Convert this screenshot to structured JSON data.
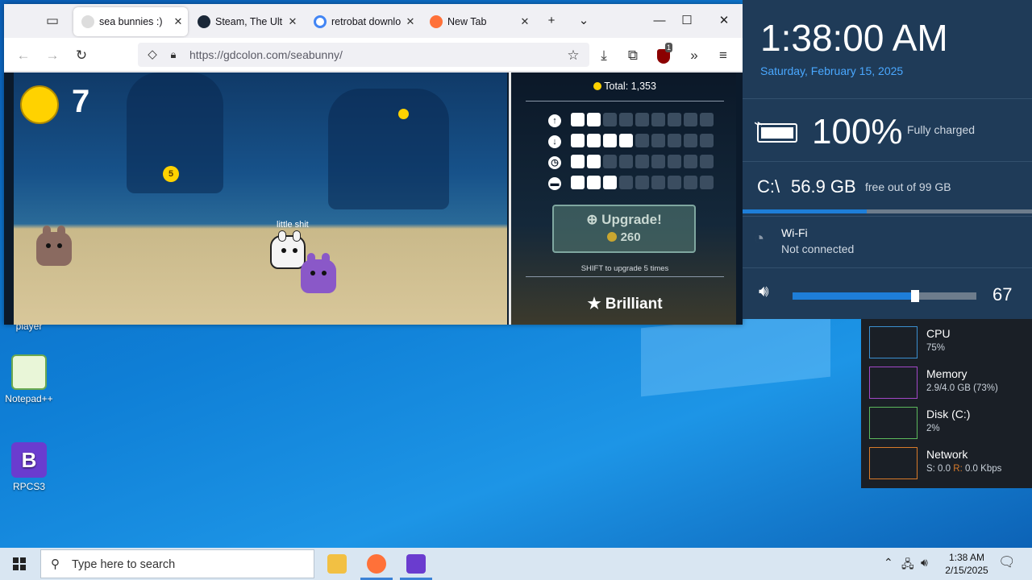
{
  "browser": {
    "tabs": [
      {
        "label": "sea bunnies :)",
        "active": true
      },
      {
        "label": "Steam, The Ultimate",
        "active": false
      },
      {
        "label": "retrobat download",
        "active": false
      },
      {
        "label": "New Tab",
        "active": false
      }
    ],
    "url": "https://gdcolon.com/seabunny/",
    "extension_badge": "1"
  },
  "game": {
    "coin_count": "7",
    "small_coin_value": "5",
    "player_name": "little shit",
    "total_label": "Total: 1,353",
    "stats": [
      {
        "icon": "up-arrow-icon",
        "level": 2,
        "max": 9
      },
      {
        "icon": "down-arrow-icon",
        "level": 4,
        "max": 9
      },
      {
        "icon": "clock-icon",
        "level": 2,
        "max": 9
      },
      {
        "icon": "bed-icon",
        "level": 3,
        "max": 9
      }
    ],
    "upgrade_label": "Upgrade!",
    "upgrade_cost": "260",
    "shift_hint": "SHIFT to upgrade 5 times",
    "rank_label": "Brilliant"
  },
  "desktop": {
    "icons": [
      {
        "label": "player"
      },
      {
        "label": "Notepad++"
      },
      {
        "label": "RPCS3"
      }
    ]
  },
  "overlay": {
    "time": "1:38:00 AM",
    "date": "Saturday, February 15, 2025",
    "battery_percent": "100%",
    "battery_status": "Fully charged",
    "drive_label": "C:\\",
    "drive_free": "56.9 GB",
    "drive_detail": "free out of 99 GB",
    "drive_used_fraction": 0.43,
    "wifi_title": "Wi-Fi",
    "wifi_status": "Not connected",
    "volume": "67",
    "volume_fraction": 0.67
  },
  "resource_monitor": [
    {
      "name": "CPU",
      "value": "75%",
      "color": "#3a8fd0"
    },
    {
      "name": "Memory",
      "value": "2.9/4.0 GB (73%)",
      "color": "#a347c8"
    },
    {
      "name": "Disk (C:)",
      "value": "2%",
      "color": "#5cb85c"
    },
    {
      "name": "Network",
      "value_s": "S: 0.0",
      "value_r_label": "R:",
      "value_r": "0.0 Kbps",
      "color": "#d87a2a"
    }
  ],
  "taskbar": {
    "search_placeholder": "Type here to search",
    "time": "1:38 AM",
    "date": "2/15/2025"
  }
}
